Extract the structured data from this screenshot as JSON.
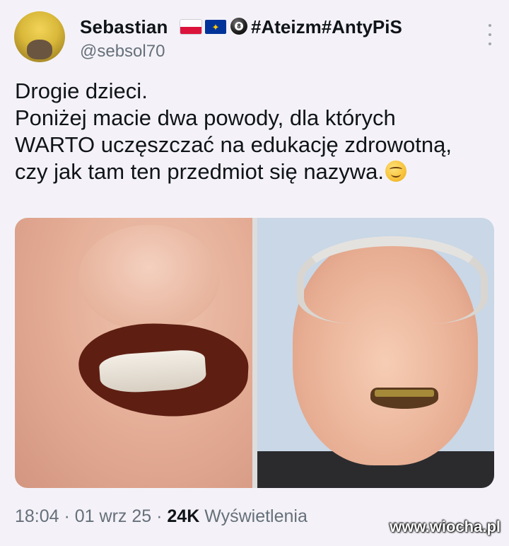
{
  "author": {
    "name": "Sebastian",
    "handle": "@sebsol70",
    "tags": "#Ateizm#AntyPiS",
    "name_emojis": [
      "flag-poland-icon",
      "flag-eu-icon",
      "eight-ball-icon"
    ]
  },
  "tweet": {
    "lines": [
      "Drogie dzieci.",
      "Poniżej macie dwa powody, dla których",
      "WARTO uczęszczać na edukację zdrowotną,",
      "czy jak tam ten przedmiot się nazywa."
    ],
    "trailing_emoji": "smiling-face-icon"
  },
  "media": {
    "images": [
      "photo-left",
      "photo-right"
    ]
  },
  "meta": {
    "time": "18:04",
    "sep1": " · ",
    "date": "01 wrz 25",
    "sep2": " · ",
    "views_count": "24K",
    "views_label": " Wyświetlenia"
  },
  "watermark": "www.wiocha.pl",
  "colors": {
    "background": "#f4f2f8",
    "text": "#0f1419",
    "secondary_text": "#66707a"
  }
}
